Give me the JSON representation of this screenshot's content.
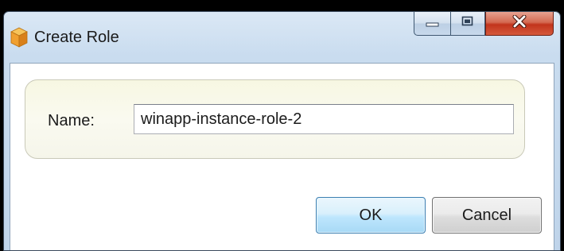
{
  "window": {
    "title": "Create Role",
    "icon": "cube-icon"
  },
  "caption_buttons": {
    "minimize_icon": "minimize-icon",
    "maximize_icon": "maximize-icon",
    "close_icon": "close-icon"
  },
  "form": {
    "name_label": "Name:",
    "name_value": "winapp-instance-role-2"
  },
  "buttons": {
    "ok_label": "OK",
    "cancel_label": "Cancel"
  },
  "colors": {
    "title_bar": "#c9dcef",
    "panel_background": "#f7f7e2",
    "ok_button": "#bee6fd",
    "close_button": "#c2341c",
    "cube_icon": "#f0a030"
  }
}
